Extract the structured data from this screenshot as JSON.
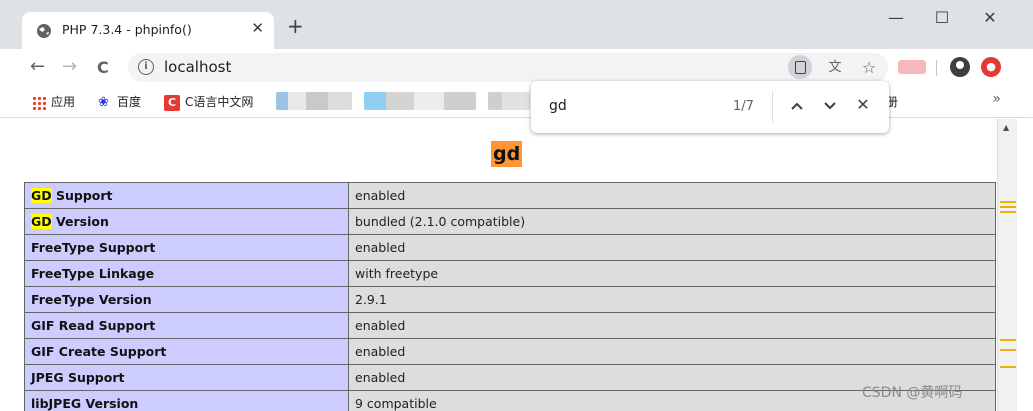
{
  "tab": {
    "title": "PHP 7.3.4 - phpinfo()",
    "close": "✕",
    "new_tab": "+"
  },
  "window": {
    "minimize": "—",
    "maximize": "☐",
    "close": "✕"
  },
  "toolbar": {
    "back": "←",
    "forward": "→",
    "reload": "C",
    "url": "localhost",
    "star": "☆",
    "translate": "文"
  },
  "bookmarks": [
    {
      "label": "应用",
      "icon": "apps-icon"
    },
    {
      "label": "百度",
      "icon": "baidu-paw-icon"
    },
    {
      "label": "C语言中文网",
      "icon": "c-logo-icon"
    }
  ],
  "bookmarks_more": "»",
  "bookmark_partial": "册",
  "findbar": {
    "query": "gd",
    "count": "1/7",
    "prev": "⌃",
    "next": "⌄",
    "close": "✕"
  },
  "page": {
    "section_title": "gd",
    "rows": [
      {
        "name_hl": "GD",
        "name": " Support",
        "value": "enabled"
      },
      {
        "name_hl": "GD",
        "name": " Version",
        "value": "bundled (2.1.0 compatible)"
      },
      {
        "name_hl": "",
        "name": "FreeType Support",
        "value": "enabled"
      },
      {
        "name_hl": "",
        "name": "FreeType Linkage",
        "value": "with freetype"
      },
      {
        "name_hl": "",
        "name": "FreeType Version",
        "value": "2.9.1"
      },
      {
        "name_hl": "",
        "name": "GIF Read Support",
        "value": "enabled"
      },
      {
        "name_hl": "",
        "name": "GIF Create Support",
        "value": "enabled"
      },
      {
        "name_hl": "",
        "name": "JPEG Support",
        "value": "enabled"
      },
      {
        "name_hl": "",
        "name": "libJPEG Version",
        "value": "9 compatible"
      }
    ]
  },
  "watermark": "CSDN @黄啊码",
  "colors": {
    "highlight_current": "#ff9632",
    "highlight_other": "#ffff00",
    "entry_bg": "#ccccff",
    "value_bg": "#dddddd"
  }
}
